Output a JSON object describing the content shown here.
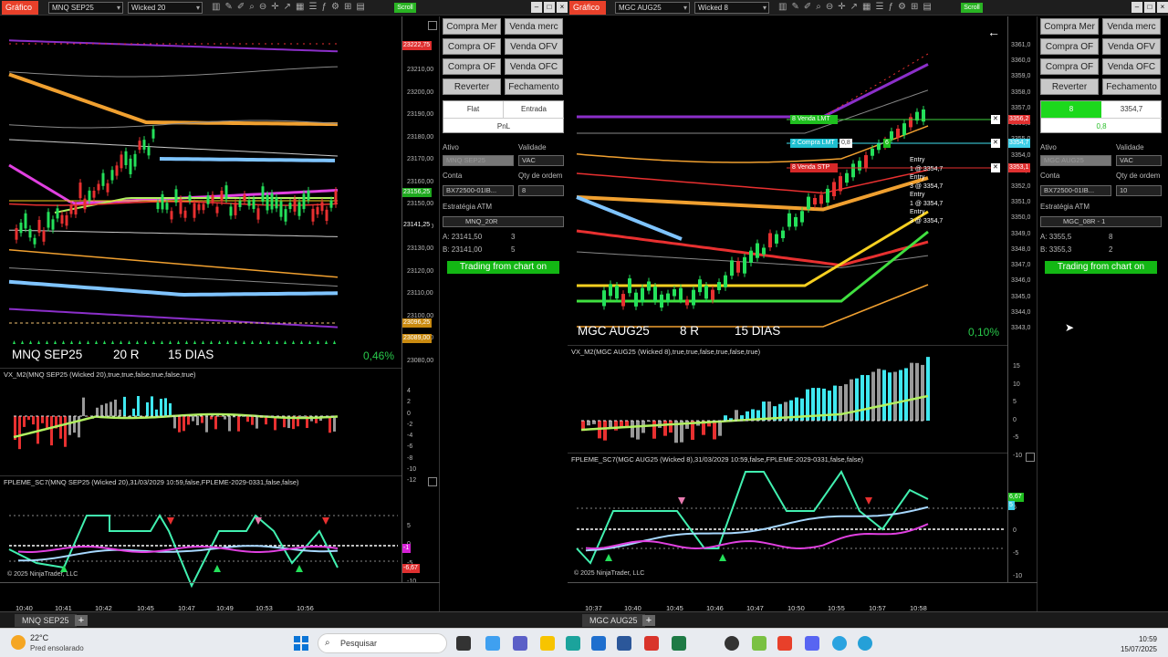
{
  "left": {
    "title_btn": "Gráfico",
    "instrument": "MNQ SEP25",
    "bartype": "Wicked 20",
    "scroll_label": "Scroll",
    "main_label_instrument": "MNQ SEP25",
    "main_label_bars": "20 R",
    "main_label_days": "15 DIAS",
    "pct": "0,46%",
    "y_labels": [
      "23210,00",
      "23200,00",
      "23190,00",
      "23180,00",
      "23170,00",
      "23160,00",
      "23150,00",
      "23140,00",
      "23130,00",
      "23120,00",
      "23110,00",
      "23100,00",
      "23090,00",
      "23080,00"
    ],
    "price_boxes": [
      "23222,75",
      "23156,25",
      "23141,25",
      "23096,25",
      "23089,00"
    ],
    "vx_title": "VX_M2(MNQ SEP25 (Wicked 20),true,true,false,true,false,true)",
    "vx_labels": [
      "4",
      "2",
      "0",
      "-2",
      "-4",
      "-6",
      "-8",
      "-10",
      "-12"
    ],
    "fp_title": "FPLEME_SC7(MNQ SEP25 (Wicked 20),31/03/2029 10:59,false,FPLEME-2029-0331,false,false)",
    "fp_labels": [
      "5",
      "0",
      "-5",
      "-10"
    ],
    "fp_boxes": [
      "-1",
      "-6,67"
    ],
    "copyright": "© 2025 NinjaTrader, LLC",
    "x_labels": [
      "10:40",
      "10:41",
      "10:42",
      "10:45",
      "10:47",
      "10:49",
      "10:53",
      "10:56"
    ],
    "tab": "MNQ SEP25",
    "side": {
      "buttons": [
        "Compra Mer",
        "Venda merc",
        "Compra OF",
        "Venda OFV",
        "Compra OF",
        "Venda OFC",
        "Reverter",
        "Fechamento"
      ],
      "pos_header": [
        "Flat",
        "Entrada"
      ],
      "pnl": "PnL",
      "ativo_label": "Ativo",
      "validade_label": "Validade",
      "ativo_value": "MNQ SEP25",
      "validade_value": "VAC",
      "conta_label": "Conta",
      "qty_label": "Qty de ordem",
      "conta_value": "BX72500-01IB...",
      "qty_value": "8",
      "atm_label": "Estratégia ATM",
      "atm_value": "MNQ_20R",
      "ask": "A:  23141,50",
      "ask_qty": "3",
      "bid": "B:  23141,00",
      "bid_qty": "5",
      "trade_btn": "Trading from chart on"
    }
  },
  "right": {
    "title_btn": "Gráfico",
    "instrument": "MGC AUG25",
    "bartype": "Wicked 8",
    "scroll_label": "Scroll",
    "main_label_instrument": "MGC AUG25",
    "main_label_bars": "8 R",
    "main_label_days": "15 DIAS",
    "pct": "0,10%",
    "y_labels": [
      "3361,0",
      "3360,0",
      "3359,0",
      "3358,0",
      "3357,0",
      "3356,0",
      "3355,0",
      "3354,0",
      "3353,0",
      "3352,0",
      "3351,0",
      "3350,0",
      "3349,0",
      "3348,0",
      "3347,0",
      "3346,0",
      "3345,0",
      "3344,0",
      "3343,0"
    ],
    "price_boxes": [
      "3356,2",
      "3354,7",
      "3353,1"
    ],
    "orders": [
      "8  Venda LMT",
      "2  Compra LMT",
      "8  Venda STP"
    ],
    "order_extra": [
      "0,8",
      "6"
    ],
    "entries": [
      "Entry",
      "1 @ 3354,7",
      "Entry",
      "3 @ 3354,7",
      "Entry",
      "1 @ 3354,7",
      "Entry",
      "3 @ 3354,7"
    ],
    "vx_title": "VX_M2(MGC AUG25 (Wicked 8),true,true,false,true,false,true)",
    "vx_labels": [
      "15",
      "10",
      "5",
      "0",
      "-5",
      "-10"
    ],
    "fp_title": "FPLEME_SC7(MGC AUG25 (Wicked 8),31/03/2029 10:59,false,FPLEME-2029-0331,false,false)",
    "fp_labels": [
      "5",
      "0",
      "-5",
      "-10"
    ],
    "fp_boxes": [
      "6,67",
      "5"
    ],
    "copyright": "© 2025 NinjaTrader, LLC",
    "x_labels": [
      "10:37",
      "10:40",
      "10:45",
      "10:46",
      "10:47",
      "10:50",
      "10:55",
      "10:57",
      "10:58"
    ],
    "tab": "MGC AUG25",
    "side": {
      "buttons": [
        "Compra Mer",
        "Venda merc",
        "Compra OF",
        "Venda OFV",
        "Compra OF",
        "Venda OFC",
        "Reverter",
        "Fechamento"
      ],
      "pos_qty": "8",
      "pos_price": "3354,7",
      "pos_pnl": "0,8",
      "ativo_label": "Ativo",
      "validade_label": "Validade",
      "ativo_value": "MGC AUG25",
      "validade_value": "VAC",
      "conta_label": "Conta",
      "qty_label": "Qty de ordem",
      "conta_value": "BX72500-01IB...",
      "qty_value": "10",
      "atm_label": "Estratégia ATM",
      "atm_value": "MGC_08R - 1",
      "ask": "A:  3355,5",
      "ask_qty": "8",
      "bid": "B:  3355,3",
      "bid_qty": "2",
      "trade_btn": "Trading from chart on"
    }
  },
  "taskbar": {
    "temp": "22°C",
    "weather": "Pred ensolarado",
    "search_placeholder": "Pesquisar",
    "time": "10:59",
    "date": "15/07/2025"
  }
}
